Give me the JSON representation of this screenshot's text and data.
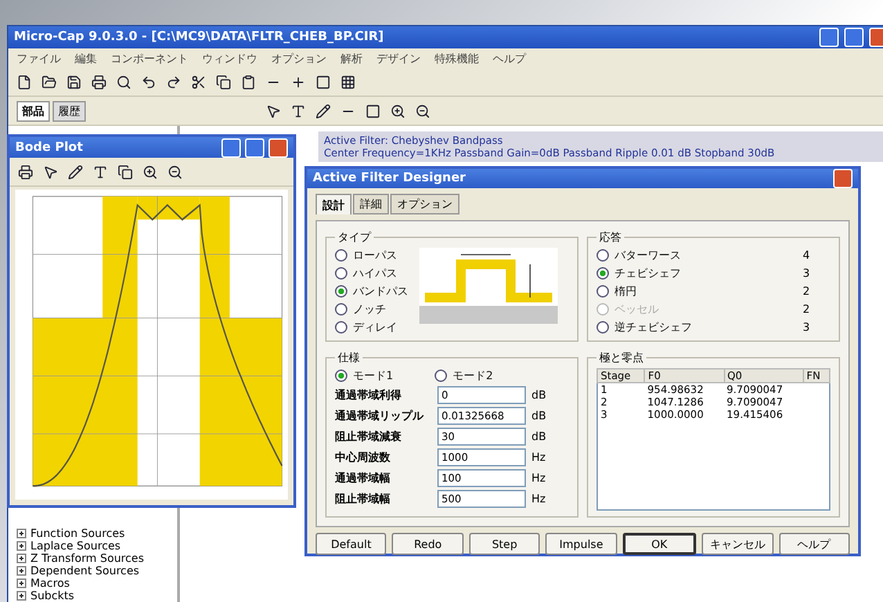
{
  "main_window": {
    "title": "Micro-Cap 9.0.3.0 - [C:\\MC9\\DATA\\FLTR_CHEB_BP.CIR]",
    "menu": [
      "ファイル",
      "編集",
      "コンポーネント",
      "ウィンドウ",
      "オプション",
      "解析",
      "デザイン",
      "特殊機能",
      "ヘルプ"
    ],
    "panel_tabs": [
      {
        "label": "部品",
        "selected": true
      },
      {
        "label": "履歴",
        "selected": false
      }
    ],
    "component_tree": [
      "Function Sources",
      "Laplace Sources",
      "Z Transform Sources",
      "Dependent Sources",
      "Macros",
      "Subckts"
    ],
    "circuit_note": [
      "Active Filter: Chebyshev Bandpass",
      "Center Frequency=1KHz Passband Gain=0dB Passband Ripple 0.01 dB Stopband 30dB"
    ]
  },
  "bode_window": {
    "title": "Bode Plot"
  },
  "dialog": {
    "title": "Active Filter Designer",
    "tabs": [
      {
        "label": "設計",
        "selected": true
      },
      {
        "label": "詳細",
        "selected": false
      },
      {
        "label": "オプション",
        "selected": false
      }
    ],
    "type_group": {
      "title": "タイプ",
      "options": [
        {
          "label": "ローパス",
          "selected": false
        },
        {
          "label": "ハイパス",
          "selected": false
        },
        {
          "label": "バンドパス",
          "selected": true
        },
        {
          "label": "ノッチ",
          "selected": false
        },
        {
          "label": "ディレイ",
          "selected": false
        }
      ]
    },
    "response_group": {
      "title": "応答",
      "options": [
        {
          "label": "バターワース",
          "order": "4",
          "selected": false,
          "disabled": false
        },
        {
          "label": "チェビシェフ",
          "order": "3",
          "selected": true,
          "disabled": false
        },
        {
          "label": "楕円",
          "order": "2",
          "selected": false,
          "disabled": false
        },
        {
          "label": "ベッセル",
          "order": "2",
          "selected": false,
          "disabled": true
        },
        {
          "label": "逆チェビシェフ",
          "order": "3",
          "selected": false,
          "disabled": false
        }
      ]
    },
    "spec_group": {
      "title": "仕様",
      "modes": [
        {
          "label": "モード1",
          "selected": true
        },
        {
          "label": "モード2",
          "selected": false
        }
      ],
      "fields": [
        {
          "label": "通過帯域利得",
          "value": "0",
          "unit": "dB"
        },
        {
          "label": "通過帯域リップル",
          "value": "0.01325668",
          "unit": "dB"
        },
        {
          "label": "阻止帯域減衰",
          "value": "30",
          "unit": "dB"
        },
        {
          "label": "中心周波数",
          "value": "1000",
          "unit": "Hz"
        },
        {
          "label": "通過帯域幅",
          "value": "100",
          "unit": "Hz"
        },
        {
          "label": "阻止帯域幅",
          "value": "500",
          "unit": "Hz"
        }
      ]
    },
    "poles_group": {
      "title": "極と零点",
      "columns": [
        "Stage",
        "F0",
        "Q0",
        "FN"
      ],
      "rows": [
        [
          "1",
          "954.98632",
          "9.7090047"
        ],
        [
          "2",
          "1047.1286",
          "9.7090047"
        ],
        [
          "3",
          "1000.0000",
          "19.415406"
        ]
      ]
    },
    "buttons": [
      {
        "label": "Default",
        "default": false
      },
      {
        "label": "Redo",
        "default": false
      },
      {
        "label": "Step",
        "default": false
      },
      {
        "label": "Impulse",
        "default": false
      },
      {
        "label": "OK",
        "default": true
      },
      {
        "label": "キャンセル",
        "default": false
      },
      {
        "label": "ヘルプ",
        "default": false
      }
    ]
  }
}
